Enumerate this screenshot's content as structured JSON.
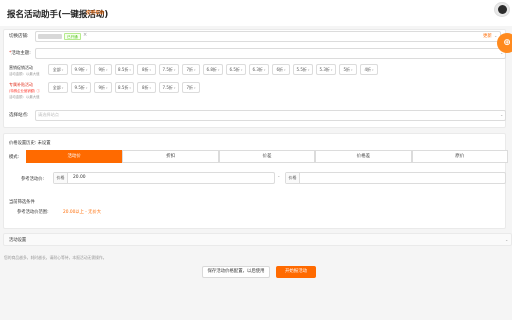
{
  "header": {
    "title": "报名活动助手(一键报活动)",
    "help_link": "使用帮助"
  },
  "shop": {
    "label": "切换店铺:",
    "tag": "已开通",
    "close_icon": "×",
    "refresh": "更新"
  },
  "activity_theme": {
    "label": "活动主题:"
  },
  "discount_filter": {
    "label": "营销促销活动",
    "sub1": "活动金额：以最大值",
    "options": [
      "全部",
      "9.9折",
      "9折",
      "8.5折",
      "8折",
      "7.5折",
      "7折",
      "6.8折",
      "6.5折",
      "6.3折",
      "6折",
      "5.5折",
      "5.3折",
      "5折",
      "4折"
    ]
  },
  "special_filter": {
    "label": "专属补贴活动",
    "sub_red": "(特殊企业营销额) ⓘ",
    "sub2": "活动金额：以最大值",
    "options": [
      "全部",
      "9.5折",
      "9折",
      "8.5折",
      "8折",
      "7.5折",
      "7折"
    ]
  },
  "site_select": {
    "label": "选择站点:",
    "placeholder": "请选择站点"
  },
  "price_panel": {
    "history_label": "价格设置历史: 未设置",
    "mode_label": "模式:",
    "modes": [
      "活动价",
      "折扣",
      "价差",
      "价格差",
      "原价"
    ],
    "ref_price_label": "参考活动价:",
    "price_prefix": "价格",
    "price_value": "20.00",
    "price_prefix2": "价格",
    "price_separator": "-",
    "current_filter_label": "当前筛选条件",
    "activity_range_label": "参考活动价范围:",
    "activity_range_value": "20.00以上 - 无价大"
  },
  "activity_settings": {
    "label": "活动设置"
  },
  "footer": {
    "note": "您的商品越多，耗时越长，请耐心等待，本报活动无需操作。",
    "save_button": "保存活动价格配置，以后使用",
    "primary_button": "开始报活动"
  },
  "colors": {
    "accent": "#ff6a00",
    "background": "#f5f5f5",
    "tag_green": "#52c41a"
  }
}
